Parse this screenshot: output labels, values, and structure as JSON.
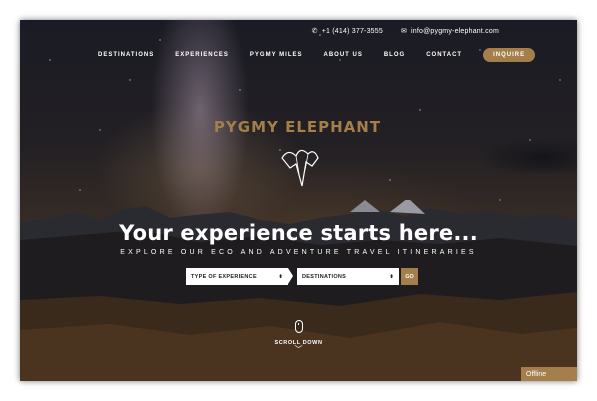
{
  "contact": {
    "phone": "+1 (414) 377-3555",
    "email": "info@pygmy-elephant.com",
    "phone_icon": "phone-icon",
    "email_icon": "mail-icon"
  },
  "nav": {
    "items": [
      "DESTINATIONS",
      "EXPERIENCES",
      "PYGMY MILES",
      "ABOUT US",
      "BLOG",
      "CONTACT"
    ],
    "cta": "INQUIRE"
  },
  "logo": {
    "brand": "PYGMY ELEPHANT"
  },
  "hero": {
    "headline": "Your experience starts here...",
    "subline": "EXPLORE OUR ECO AND ADVENTURE TRAVEL ITINERARIES"
  },
  "search": {
    "experience_label": "TYPE OF EXPERIENCE",
    "destination_label": "DESTINATIONS",
    "go_label": "GO"
  },
  "scroll": {
    "label": "SCROLL DOWN"
  },
  "chat": {
    "status": "Offline"
  },
  "colors": {
    "accent": "#a47e4b",
    "text": "#ffffff"
  }
}
